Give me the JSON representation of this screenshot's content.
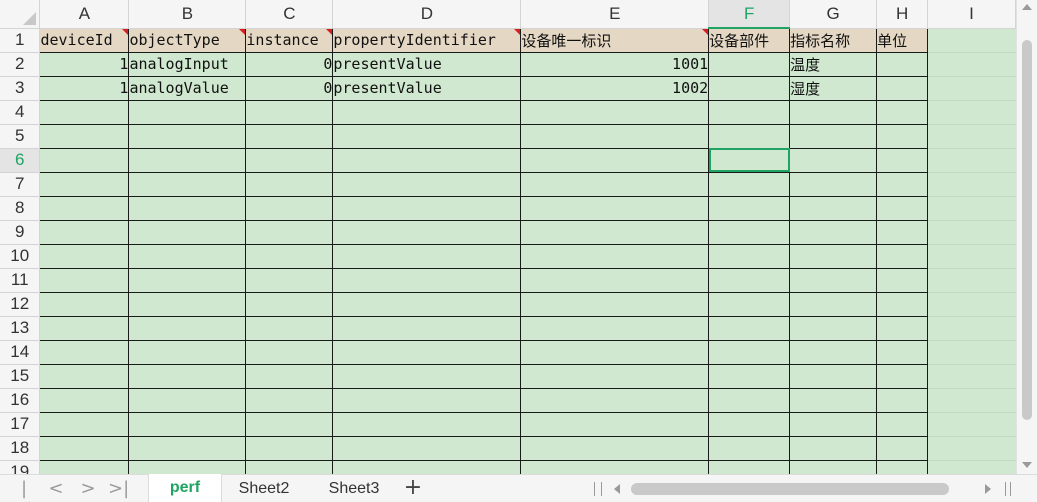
{
  "columns": [
    "A",
    "B",
    "C",
    "D",
    "E",
    "F",
    "G",
    "H",
    "I"
  ],
  "active_column": "F",
  "active_row": "6",
  "row_numbers": [
    "1",
    "2",
    "3",
    "4",
    "5",
    "6",
    "7",
    "8",
    "9",
    "10",
    "11",
    "12",
    "13",
    "14",
    "15",
    "16",
    "17",
    "18",
    "19"
  ],
  "header_row": [
    "deviceId",
    "objectType",
    "instance",
    "propertyIdentifier",
    "设备唯一标识",
    "设备部件",
    "指标名称",
    "单位",
    ""
  ],
  "rows": [
    [
      "1",
      "analogInput",
      "0",
      "presentValue",
      "1001",
      "",
      "温度",
      "",
      ""
    ],
    [
      "1",
      "analogValue",
      "0",
      "presentValue",
      "1002",
      "",
      "湿度",
      "",
      ""
    ]
  ],
  "sheet_tabs": [
    "perf",
    "Sheet2",
    "Sheet3"
  ],
  "active_tab": "perf",
  "add_tab_label": "+",
  "nav_icons": {
    "first": "|<",
    "prev": "<",
    "next": ">",
    "last": ">|"
  },
  "colors": {
    "cell_fill": "#cfe8cf",
    "header_fill": "#e4d8c4",
    "accent": "#1fa463",
    "note_marker": "#d42020"
  }
}
